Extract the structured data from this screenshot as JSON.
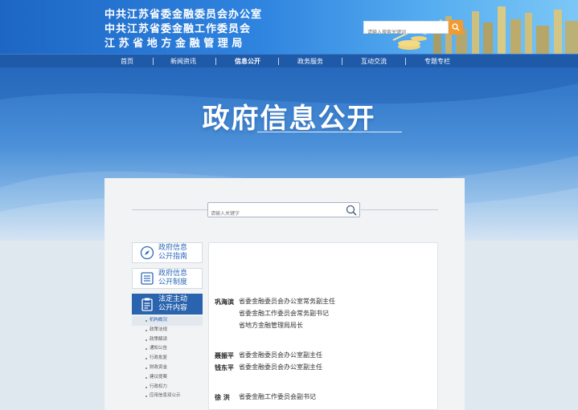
{
  "header": {
    "title_lines": [
      "中共江苏省委金融委员会办公室",
      "中共江苏省委金融工作委员会",
      "江苏省地方金融管理局"
    ],
    "search_placeholder": "请输入搜索关键词",
    "search_button_color": "#f29a2e"
  },
  "nav": {
    "items": [
      {
        "label": "首页"
      },
      {
        "label": "新闻资讯"
      },
      {
        "label": "信息公开",
        "active": true
      },
      {
        "label": "政务服务"
      },
      {
        "label": "互动交流"
      },
      {
        "label": "专题专栏"
      }
    ]
  },
  "banner": {
    "title": "政府信息公开"
  },
  "main_search": {
    "placeholder": "请输入关键字"
  },
  "sidebar": {
    "items": [
      {
        "label_line1": "政府信息",
        "label_line2": "公开指南",
        "icon": "compass-icon"
      },
      {
        "label_line1": "政府信息",
        "label_line2": "公开制度",
        "icon": "document-list-icon"
      },
      {
        "label_line1": "法定主动",
        "label_line2": "公开内容",
        "icon": "clipboard-icon",
        "active": true
      }
    ],
    "submenu": [
      {
        "label": "机构概况",
        "selected": true
      },
      {
        "label": "政策法规"
      },
      {
        "label": "政策解读"
      },
      {
        "label": "通知公告"
      },
      {
        "label": "行政批复"
      },
      {
        "label": "财政资金"
      },
      {
        "label": "建议提案"
      },
      {
        "label": "行政权力"
      },
      {
        "label": "应用信息双公示"
      }
    ]
  },
  "leaders": [
    {
      "name": "巩海滨",
      "roles": [
        "省委金融委员会办公室常务副主任",
        "省委金融工作委员会常务副书记",
        "省地方金融管理局局长"
      ]
    },
    {
      "name": "聂振平",
      "roles": [
        "省委金融委员会办公室副主任"
      ]
    },
    {
      "name": "钱东平",
      "roles": [
        "省委金融委员会办公室副主任"
      ]
    },
    {
      "name": "徐 洪",
      "roles": [
        "省委金融工作委员会副书记"
      ]
    }
  ],
  "colors": {
    "brand_blue": "#1f5aa9",
    "accent_orange": "#f29a2e",
    "sidebar_active": "#2a63ae"
  }
}
